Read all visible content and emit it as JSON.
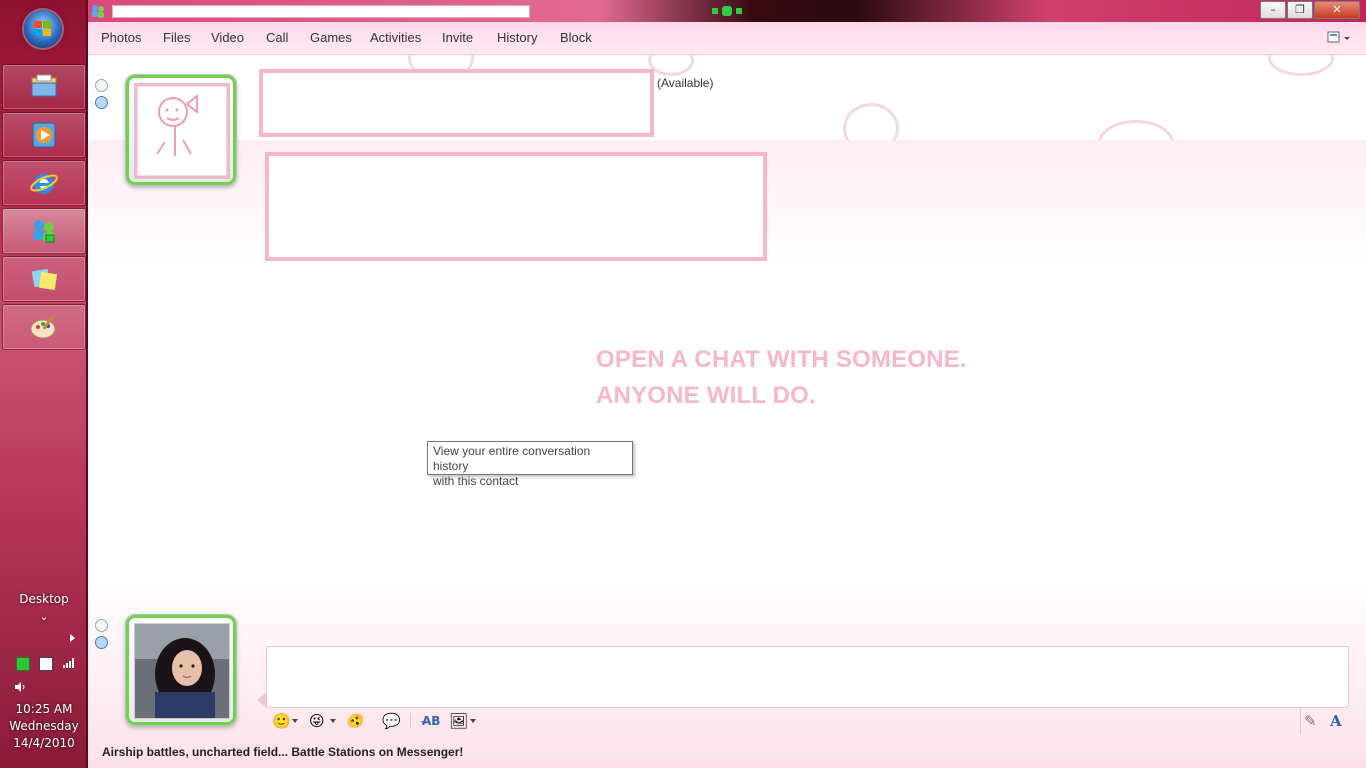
{
  "taskbar": {
    "desktop_label": "Desktop",
    "clock": {
      "time": "10:25 AM",
      "day": "Wednesday",
      "date": "14/4/2010"
    },
    "buttons": [
      {
        "icon": "file-explorer-icon"
      },
      {
        "icon": "media-player-icon"
      },
      {
        "icon": "internet-explorer-icon"
      },
      {
        "icon": "messenger-icon",
        "active": true
      },
      {
        "icon": "sticky-notes-icon"
      },
      {
        "icon": "paint-icon"
      }
    ]
  },
  "menu": {
    "items": [
      "Photos",
      "Files",
      "Video",
      "Call",
      "Games",
      "Activities",
      "Invite",
      "History",
      "Block"
    ]
  },
  "contact": {
    "status": "(Available)"
  },
  "conversation": {
    "line1": "OPEN A CHAT WITH SOMEONE.",
    "line2": "ANYONE WILL DO."
  },
  "tooltip": {
    "line1": "View your entire conversation history",
    "line2": "with this contact"
  },
  "ad": {
    "text": "Airship battles, uncharted field... Battle Stations on Messenger!"
  },
  "colors": {
    "accent_pink": "#f7b6cd",
    "frame_green": "#6ed34a",
    "taskbar": "#b3254a"
  }
}
